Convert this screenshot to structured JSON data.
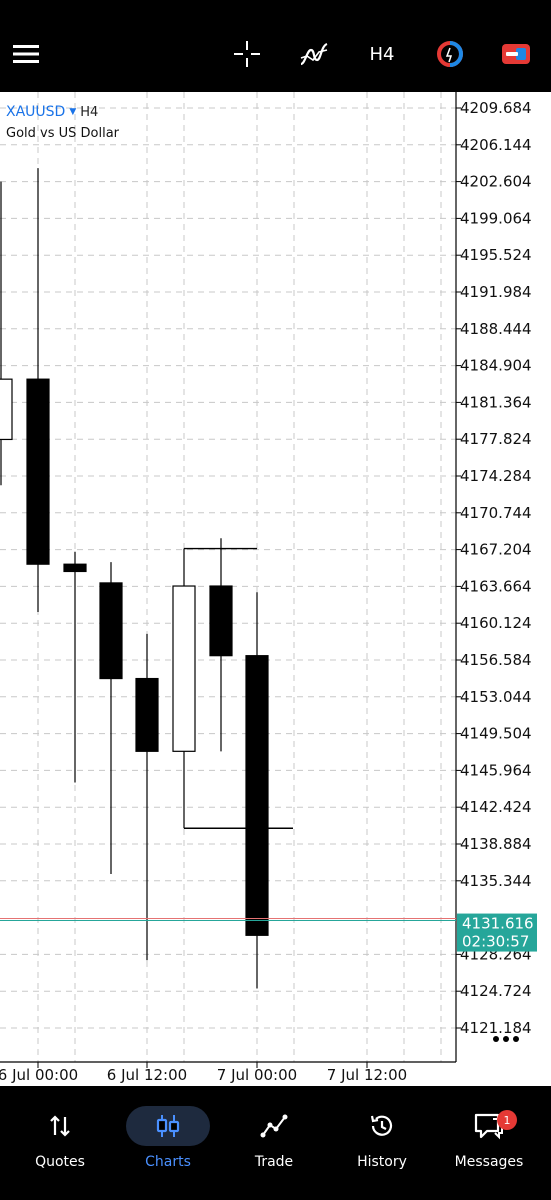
{
  "toolbar": {
    "menu_icon": "hamburger-menu-icon",
    "crosshair_icon": "crosshair-icon",
    "indicators_icon": "indicators-icon",
    "timeframe": "H4",
    "colors": {
      "background": "#000000",
      "icon": "#ffffff",
      "accent_red": "#e53935",
      "accent_blue": "#1e88e5"
    }
  },
  "chart": {
    "symbol": "XAUUSD",
    "timeframe": "H4",
    "description": "Gold vs US Dollar",
    "price_labels": [
      "4209.684",
      "4206.144",
      "4202.604",
      "4199.064",
      "4195.524",
      "4191.984",
      "4188.444",
      "4184.904",
      "4181.364",
      "4177.824",
      "4174.284",
      "4170.744",
      "4167.204",
      "4163.664",
      "4160.124",
      "4156.584",
      "4153.044",
      "4149.504",
      "4145.964",
      "4142.424",
      "4138.884",
      "4135.344",
      "4128.264",
      "4124.724",
      "4121.184"
    ],
    "current_price": "4131.616",
    "countdown": "02:30:57",
    "time_labels": [
      "6 Jul 00:00",
      "6 Jul 12:00",
      "7 Jul 00:00",
      "7 Jul 12:00"
    ],
    "colors": {
      "bull": "#ffffff",
      "bear": "#000000",
      "price_tag": "#26a69a",
      "grid": "#c8c8c8",
      "bid_line": "#26a69a",
      "ask_line": "#e57373"
    }
  },
  "chart_data": {
    "type": "candlestick",
    "symbol": "XAUUSD",
    "timeframe": "H4",
    "ylim": [
      4119.5,
      4211.5
    ],
    "candles": [
      {
        "open": 4177.8,
        "high": 4202.6,
        "low": 4173.4,
        "close": 4183.6
      },
      {
        "open": 4183.6,
        "high": 4203.9,
        "low": 4161.2,
        "close": 4165.8
      },
      {
        "open": 4165.8,
        "high": 4167.0,
        "low": 4144.8,
        "close": 4165.1
      },
      {
        "open": 4164.0,
        "high": 4166.0,
        "low": 4136.0,
        "close": 4154.8
      },
      {
        "open": 4154.8,
        "high": 4159.1,
        "low": 4127.7,
        "close": 4147.8
      },
      {
        "open": 4147.8,
        "high": 4167.3,
        "low": 4140.4,
        "close": 4163.7
      },
      {
        "open": 4163.7,
        "high": 4168.3,
        "low": 4147.8,
        "close": 4157.0
      },
      {
        "open": 4157.0,
        "high": 4163.1,
        "low": 4125.0,
        "close": 4130.1
      }
    ],
    "current_price": 4131.616
  },
  "nav": {
    "items": [
      {
        "label": "Quotes",
        "icon": "quotes-arrows-icon"
      },
      {
        "label": "Charts",
        "icon": "charts-candles-icon"
      },
      {
        "label": "Trade",
        "icon": "trade-line-icon"
      },
      {
        "label": "History",
        "icon": "history-clock-icon"
      },
      {
        "label": "Messages",
        "icon": "messages-chat-icon"
      }
    ],
    "active": "Charts",
    "messages_badge": "1"
  }
}
